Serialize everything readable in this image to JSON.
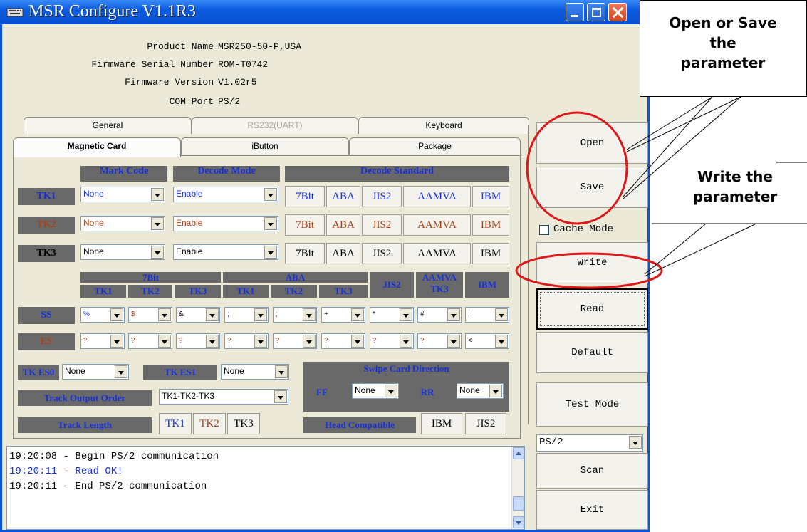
{
  "window": {
    "title": "MSR Configure V1.1R3"
  },
  "info": [
    {
      "key": "Product Name",
      "value": "MSR250-50-P,USA"
    },
    {
      "key": "Firmware Serial Number",
      "value": "ROM-T0742"
    },
    {
      "key": "Firmware Version",
      "value": "V1.02r5"
    },
    {
      "key": "COM Port",
      "value": "PS/2"
    }
  ],
  "tabs_back": [
    "General",
    "RS232(UART)",
    "Keyboard"
  ],
  "tabs_front": [
    "Magnetic Card",
    "iButton",
    "Package"
  ],
  "decode": {
    "headers": {
      "mark_code": "Mark Code",
      "decode_mode": "Decode Mode",
      "decode_standard": "Decode Standard"
    },
    "rows": [
      {
        "track": "TK1",
        "mark": "None",
        "mode": "Enable",
        "standards": [
          "7Bit",
          "ABA",
          "JIS2",
          "AAMVA",
          "IBM"
        ]
      },
      {
        "track": "TK2",
        "mark": "None",
        "mode": "Enable",
        "standards": [
          "7Bit",
          "ABA",
          "JIS2",
          "AAMVA",
          "IBM"
        ]
      },
      {
        "track": "TK3",
        "mark": "None",
        "mode": "Enable",
        "standards": [
          "7Bit",
          "ABA",
          "JIS2",
          "AAMVA",
          "IBM"
        ]
      }
    ]
  },
  "sentinel": {
    "groups": {
      "g7bit": "7Bit",
      "aba": "ABA",
      "jis2": "JIS2",
      "aamva": "AAMVA",
      "aamva_tk3": "TK3",
      "ibm": "IBM"
    },
    "sub": [
      "TK1",
      "TK2",
      "TK3",
      "TK1",
      "TK2",
      "TK3"
    ],
    "ss_label": "SS",
    "es_label": "ES",
    "ss": [
      "%",
      "$",
      "&",
      ";",
      ";",
      "+",
      "*",
      "#",
      ";"
    ],
    "es": [
      "?",
      "?",
      "?",
      "?",
      "?",
      "?",
      "?",
      "?",
      "<"
    ]
  },
  "bottom": {
    "tkes0_label": "TK ES0",
    "tkes0_value": "None",
    "tkes1_label": "TK ES1",
    "tkes1_value": "None",
    "swipe_label": "Swipe Card Direction",
    "ff_label": "FF",
    "ff_value": "None",
    "rr_label": "RR",
    "rr_value": "None",
    "order_label": "Track Output Order",
    "order_value": "TK1-TK2-TK3",
    "length_label": "Track Length",
    "length_buttons": [
      "TK1",
      "TK2",
      "TK3"
    ],
    "head_label": "Head Compatible",
    "head_buttons": [
      "IBM",
      "JIS2"
    ]
  },
  "buttons": {
    "open": "Open",
    "save": "Save",
    "cache_mode": "Cache Mode",
    "write": "Write",
    "read": "Read",
    "default": "Default",
    "test_mode": "Test Mode",
    "port_value": "PS/2",
    "scan": "Scan",
    "exit": "Exit"
  },
  "log": [
    {
      "text": "19:20:08 - Begin PS/2 communication",
      "color": "#000000"
    },
    {
      "text": "19:20:11 - Read OK!",
      "color": "#1730d8"
    },
    {
      "text": "19:20:11 - End PS/2 communication",
      "color": "#000000"
    }
  ],
  "callouts": {
    "open_save": [
      "Open or Save",
      "the",
      "parameter"
    ],
    "write": [
      "Write the",
      "parameter"
    ]
  },
  "colors": {
    "title_blue": "#0a54e3",
    "label_gray": "#696969",
    "header_text": "#1730d8",
    "tk2_brown": "#a8421a",
    "highlight_red": "#e0181a"
  }
}
